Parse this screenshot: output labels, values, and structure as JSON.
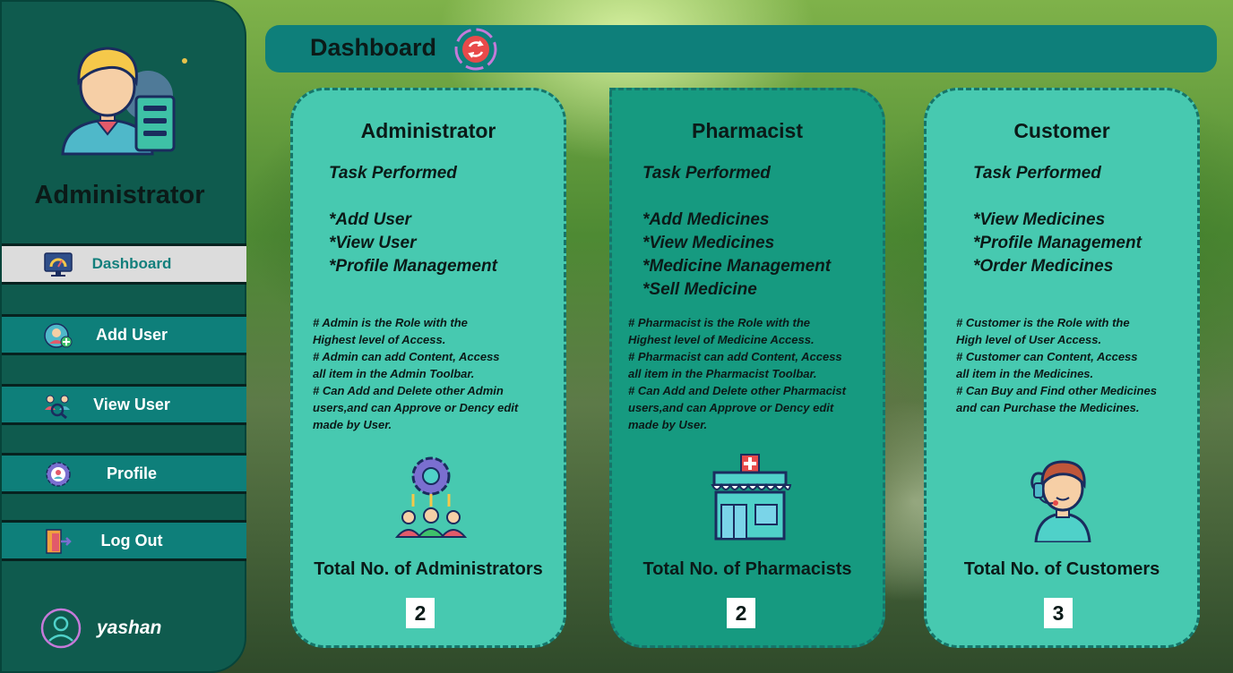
{
  "sidebar": {
    "role_title": "Administrator",
    "items": [
      {
        "label": "Dashboard",
        "icon": "monitor-gauge-icon",
        "active": true
      },
      {
        "label": "Add User",
        "icon": "add-user-icon"
      },
      {
        "label": "View User",
        "icon": "search-users-icon"
      },
      {
        "label": "Profile",
        "icon": "profile-gear-icon"
      },
      {
        "label": "Log Out",
        "icon": "logout-door-icon"
      }
    ],
    "user": {
      "name": "yashan",
      "icon": "user-circle-icon"
    }
  },
  "header": {
    "title": "Dashboard",
    "refresh_icon": "refresh-icon"
  },
  "cards": [
    {
      "title": "Administrator",
      "task_heading": "Task Performed",
      "tasks": [
        "*Add User",
        "*View User",
        "*Profile Management"
      ],
      "description": "# Admin is the Role with the\nHighest level of Access.\n# Admin can add Content, Access\nall item in the Admin Toolbar.\n# Can Add and Delete other Admin\nusers,and can Approve or Dency edit\nmade by User.",
      "icon": "admin-team-gear-icon",
      "total_label": "Total No. of Administrators",
      "count": "2"
    },
    {
      "title": "Pharmacist",
      "task_heading": "Task Performed",
      "tasks": [
        "*Add Medicines",
        "*View Medicines",
        "*Medicine Management",
        "*Sell Medicine"
      ],
      "description": "# Pharmacist is the Role with the\nHighest level of Medicine Access.\n# Pharmacist can add Content, Access\nall item in the Pharmacist Toolbar.\n# Can Add and Delete other Pharmacist\nusers,and can Approve or Dency edit\nmade by User.",
      "icon": "pharmacy-store-icon",
      "total_label": "Total No. of Pharmacists",
      "count": "2"
    },
    {
      "title": "Customer",
      "task_heading": "Task Performed",
      "tasks": [
        "*View Medicines",
        "*Profile Management",
        "*Order Medicines"
      ],
      "description": "# Customer is the Role with the\n High level of User Access.\n# Customer can Content, Access\nall item in the Medicines.\n# Can Buy and Find other Medicines\nand can Purchase the Medicines.",
      "icon": "customer-support-icon",
      "total_label": "Total No. of Customers",
      "count": "3"
    }
  ],
  "colors": {
    "sidebar": "#0f5b4e",
    "teal": "#0e7f7a",
    "card_light": "#47c9b0",
    "card_dark": "#169a80"
  }
}
